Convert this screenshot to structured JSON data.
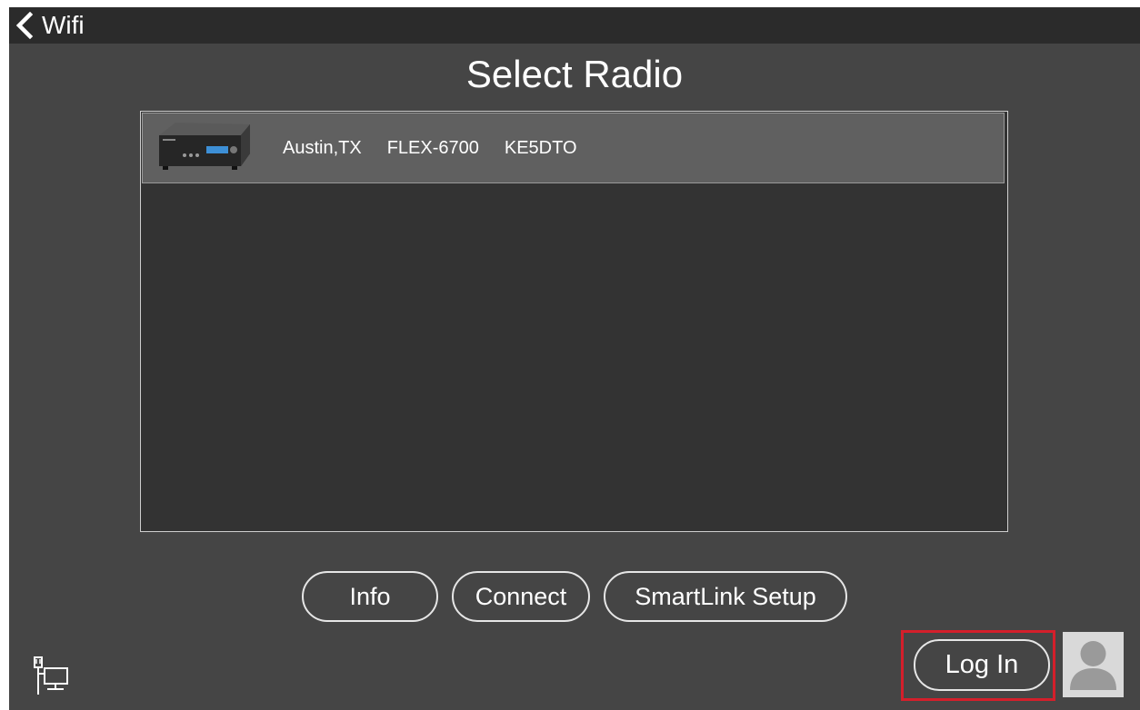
{
  "topbar": {
    "back_label": "Wifi"
  },
  "title": "Select Radio",
  "radios": [
    {
      "location": "Austin,TX",
      "model": "FLEX-6700",
      "callsign": "KE5DTO"
    }
  ],
  "buttons": {
    "info": "Info",
    "connect": "Connect",
    "smartlink_setup": "SmartLink Setup",
    "login": "Log In"
  },
  "icons": {
    "back": "chevron-left-icon",
    "network": "network-computer-icon",
    "avatar": "user-avatar-icon"
  },
  "colors": {
    "background": "#454545",
    "topbar": "#2b2b2b",
    "list_background": "#333333",
    "selected_row": "#606060",
    "highlight": "#d41f2b"
  }
}
